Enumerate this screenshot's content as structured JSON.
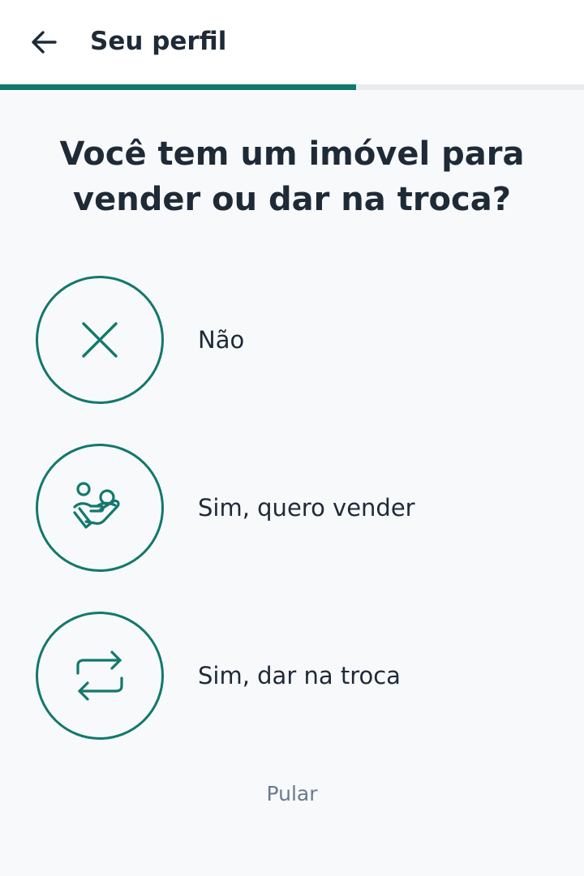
{
  "header": {
    "title": "Seu perfil",
    "back_icon": "arrow-left-icon"
  },
  "progress": {
    "fraction": 0.61,
    "color": "#13786b"
  },
  "question": "Você tem um imóvel para vender ou dar na troca?",
  "options": [
    {
      "label": "Não",
      "icon": "close-x-icon"
    },
    {
      "label": "Sim, quero vender",
      "icon": "hand-holding-people-icon"
    },
    {
      "label": "Sim, dar na troca",
      "icon": "swap-arrows-icon"
    }
  ],
  "skip_label": "Pular",
  "colors": {
    "accent": "#13786b",
    "text": "#1f2a37",
    "muted": "#6b7a8d",
    "background": "#f7f9fb"
  }
}
